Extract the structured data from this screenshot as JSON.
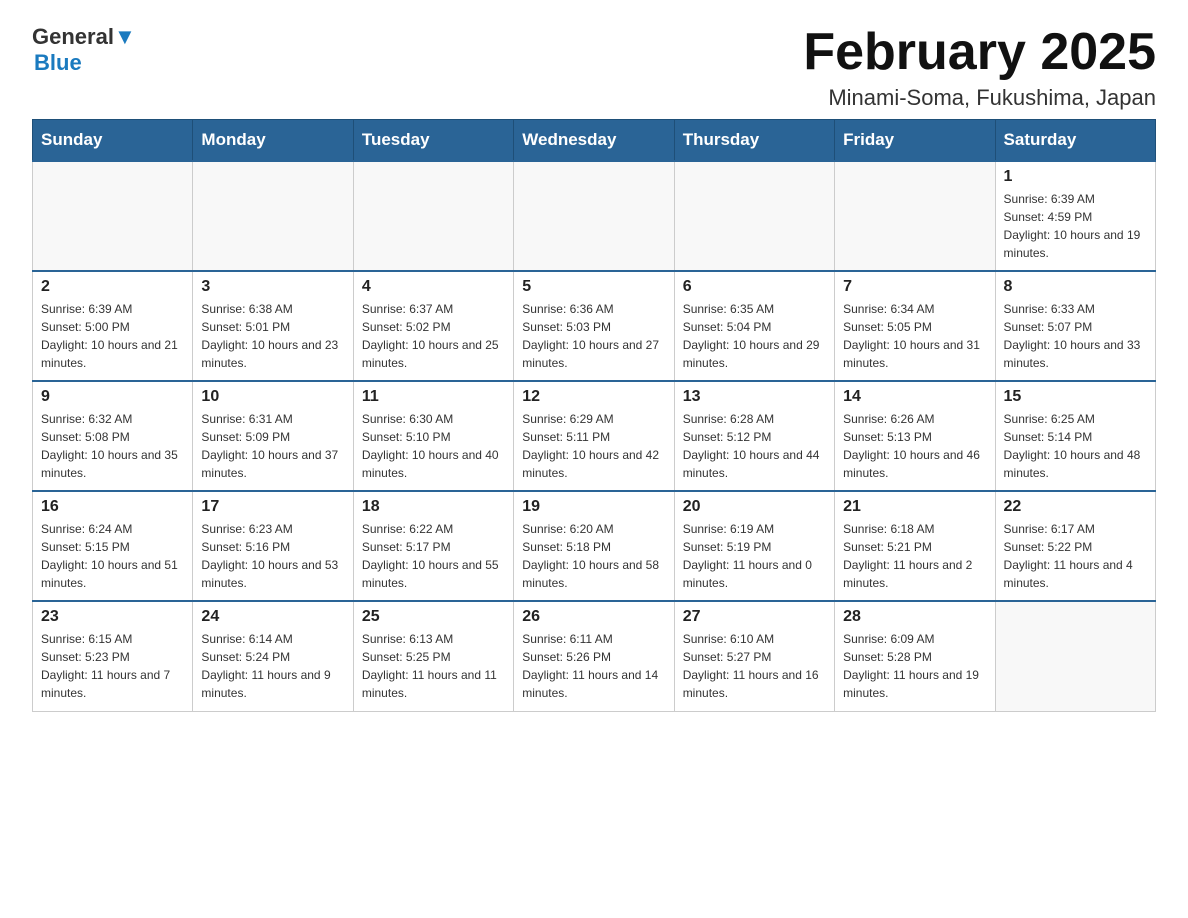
{
  "header": {
    "logo_line1": "General",
    "logo_line2": "Blue",
    "title": "February 2025",
    "subtitle": "Minami-Soma, Fukushima, Japan"
  },
  "weekdays": [
    "Sunday",
    "Monday",
    "Tuesday",
    "Wednesday",
    "Thursday",
    "Friday",
    "Saturday"
  ],
  "weeks": [
    [
      {
        "day": "",
        "empty": true
      },
      {
        "day": "",
        "empty": true
      },
      {
        "day": "",
        "empty": true
      },
      {
        "day": "",
        "empty": true
      },
      {
        "day": "",
        "empty": true
      },
      {
        "day": "",
        "empty": true
      },
      {
        "day": "1",
        "sunrise": "6:39 AM",
        "sunset": "4:59 PM",
        "daylight": "10 hours and 19 minutes."
      }
    ],
    [
      {
        "day": "2",
        "sunrise": "6:39 AM",
        "sunset": "5:00 PM",
        "daylight": "10 hours and 21 minutes."
      },
      {
        "day": "3",
        "sunrise": "6:38 AM",
        "sunset": "5:01 PM",
        "daylight": "10 hours and 23 minutes."
      },
      {
        "day": "4",
        "sunrise": "6:37 AM",
        "sunset": "5:02 PM",
        "daylight": "10 hours and 25 minutes."
      },
      {
        "day": "5",
        "sunrise": "6:36 AM",
        "sunset": "5:03 PM",
        "daylight": "10 hours and 27 minutes."
      },
      {
        "day": "6",
        "sunrise": "6:35 AM",
        "sunset": "5:04 PM",
        "daylight": "10 hours and 29 minutes."
      },
      {
        "day": "7",
        "sunrise": "6:34 AM",
        "sunset": "5:05 PM",
        "daylight": "10 hours and 31 minutes."
      },
      {
        "day": "8",
        "sunrise": "6:33 AM",
        "sunset": "5:07 PM",
        "daylight": "10 hours and 33 minutes."
      }
    ],
    [
      {
        "day": "9",
        "sunrise": "6:32 AM",
        "sunset": "5:08 PM",
        "daylight": "10 hours and 35 minutes."
      },
      {
        "day": "10",
        "sunrise": "6:31 AM",
        "sunset": "5:09 PM",
        "daylight": "10 hours and 37 minutes."
      },
      {
        "day": "11",
        "sunrise": "6:30 AM",
        "sunset": "5:10 PM",
        "daylight": "10 hours and 40 minutes."
      },
      {
        "day": "12",
        "sunrise": "6:29 AM",
        "sunset": "5:11 PM",
        "daylight": "10 hours and 42 minutes."
      },
      {
        "day": "13",
        "sunrise": "6:28 AM",
        "sunset": "5:12 PM",
        "daylight": "10 hours and 44 minutes."
      },
      {
        "day": "14",
        "sunrise": "6:26 AM",
        "sunset": "5:13 PM",
        "daylight": "10 hours and 46 minutes."
      },
      {
        "day": "15",
        "sunrise": "6:25 AM",
        "sunset": "5:14 PM",
        "daylight": "10 hours and 48 minutes."
      }
    ],
    [
      {
        "day": "16",
        "sunrise": "6:24 AM",
        "sunset": "5:15 PM",
        "daylight": "10 hours and 51 minutes."
      },
      {
        "day": "17",
        "sunrise": "6:23 AM",
        "sunset": "5:16 PM",
        "daylight": "10 hours and 53 minutes."
      },
      {
        "day": "18",
        "sunrise": "6:22 AM",
        "sunset": "5:17 PM",
        "daylight": "10 hours and 55 minutes."
      },
      {
        "day": "19",
        "sunrise": "6:20 AM",
        "sunset": "5:18 PM",
        "daylight": "10 hours and 58 minutes."
      },
      {
        "day": "20",
        "sunrise": "6:19 AM",
        "sunset": "5:19 PM",
        "daylight": "11 hours and 0 minutes."
      },
      {
        "day": "21",
        "sunrise": "6:18 AM",
        "sunset": "5:21 PM",
        "daylight": "11 hours and 2 minutes."
      },
      {
        "day": "22",
        "sunrise": "6:17 AM",
        "sunset": "5:22 PM",
        "daylight": "11 hours and 4 minutes."
      }
    ],
    [
      {
        "day": "23",
        "sunrise": "6:15 AM",
        "sunset": "5:23 PM",
        "daylight": "11 hours and 7 minutes."
      },
      {
        "day": "24",
        "sunrise": "6:14 AM",
        "sunset": "5:24 PM",
        "daylight": "11 hours and 9 minutes."
      },
      {
        "day": "25",
        "sunrise": "6:13 AM",
        "sunset": "5:25 PM",
        "daylight": "11 hours and 11 minutes."
      },
      {
        "day": "26",
        "sunrise": "6:11 AM",
        "sunset": "5:26 PM",
        "daylight": "11 hours and 14 minutes."
      },
      {
        "day": "27",
        "sunrise": "6:10 AM",
        "sunset": "5:27 PM",
        "daylight": "11 hours and 16 minutes."
      },
      {
        "day": "28",
        "sunrise": "6:09 AM",
        "sunset": "5:28 PM",
        "daylight": "11 hours and 19 minutes."
      },
      {
        "day": "",
        "empty": true
      }
    ]
  ]
}
